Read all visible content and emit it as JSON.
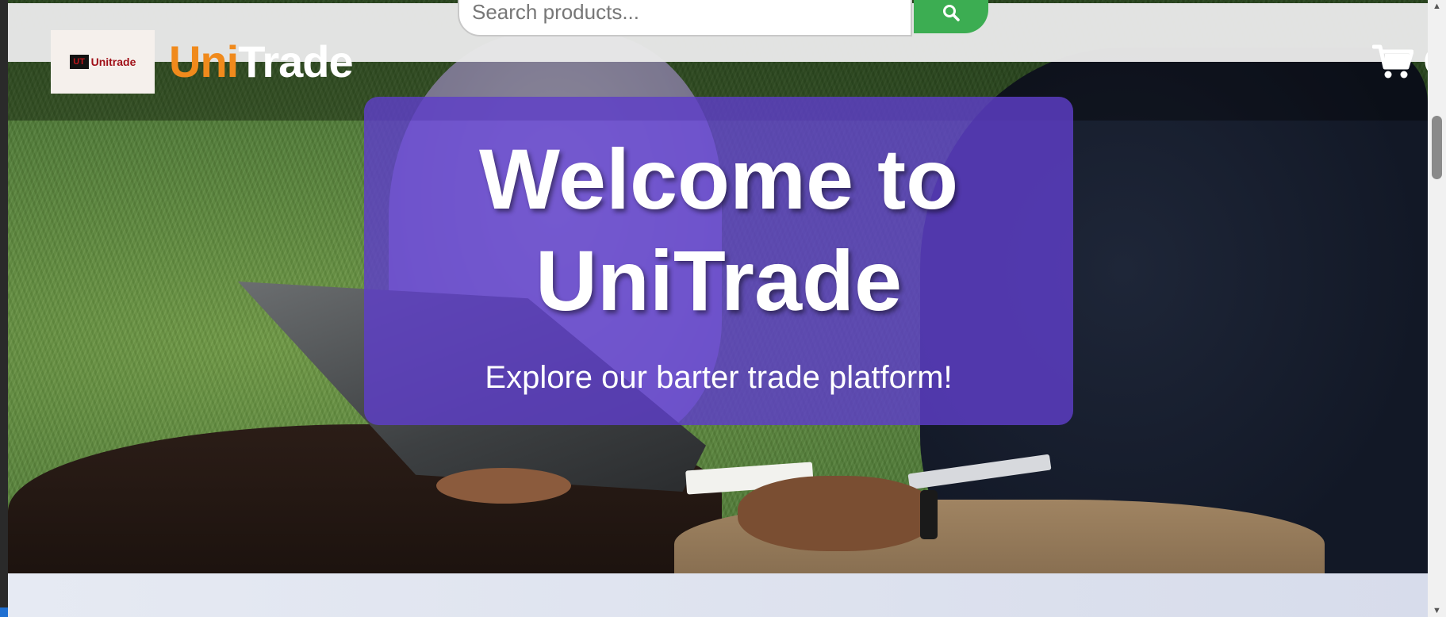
{
  "navbar": {
    "search_placeholder": "Search products...",
    "logo_mark_text": "UT",
    "logo_text": "Unitrade",
    "brand_part1": "Uni",
    "brand_part2": "Trade",
    "cart_label": "C",
    "icons": {
      "search": "search-icon",
      "cart": "shopping-cart-icon"
    }
  },
  "hero": {
    "title": "Welcome to UniTrade",
    "subtitle": "Explore our barter trade platform!"
  },
  "colors": {
    "brand_orange": "#f08a1c",
    "search_green": "#3cad52",
    "hero_card_purple": "#5e3ec8"
  }
}
